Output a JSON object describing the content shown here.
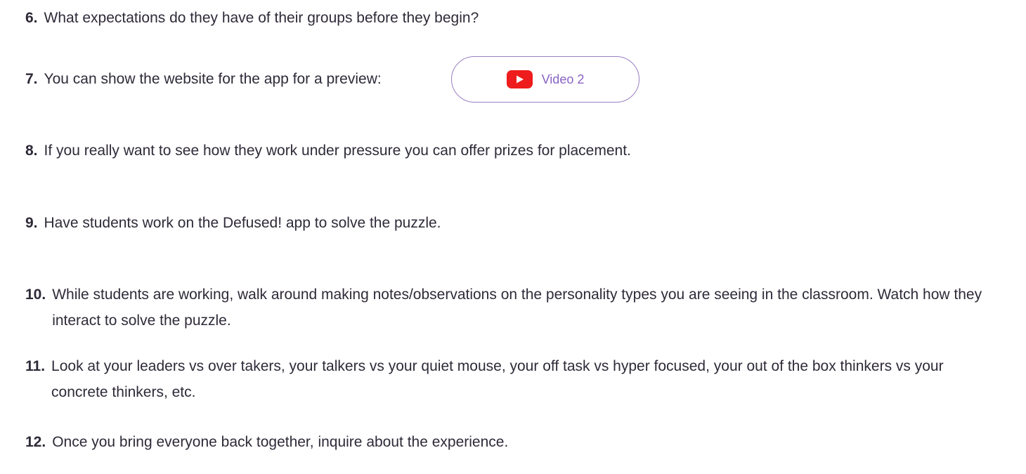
{
  "steps": [
    {
      "number": "6.",
      "text": "What expectations do they have of their groups before they begin?"
    },
    {
      "number": "7.",
      "text": "You can show the website for the app for a preview:"
    },
    {
      "number": "8.",
      "text": "If you really want to see how they work under pressure you can offer prizes for placement."
    },
    {
      "number": "9.",
      "text": "Have students work on the Defused! app to solve the puzzle."
    },
    {
      "number": "10.",
      "text": "While students are working, walk around making notes/observations on the personality types you are seeing in the classroom. Watch how they interact to solve the puzzle."
    },
    {
      "number": "11.",
      "text": "Look at your leaders vs over takers, your talkers vs your quiet mouse, your off task vs hyper focused, your out of the box thinkers vs your concrete thinkers, etc."
    },
    {
      "number": "12.",
      "text": "Once you bring everyone back together, inquire about the experience."
    }
  ],
  "video_button": {
    "label": "Video 2",
    "icon": "youtube-play-icon"
  },
  "colors": {
    "text": "#2f2a38",
    "button_border": "#9a7fc1",
    "button_text": "#8a63c3",
    "youtube_red": "#ee1c1c"
  }
}
